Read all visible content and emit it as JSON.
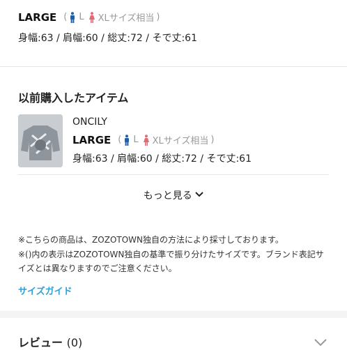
{
  "current_size": {
    "size_name": "LARGE",
    "paren_open": "(",
    "male_label": "L",
    "female_label": "XLサイズ相当",
    "paren_close": ")",
    "measurements": "身幅:63 / 肩幅:60 / 総丈:72 / そで丈:61"
  },
  "previous": {
    "title": "以前購入したアイテム",
    "item": {
      "brand": "ONCILY",
      "size_name": "LARGE",
      "paren_open": "(",
      "male_label": "L",
      "female_label": "XLサイズ相当",
      "paren_close": ")",
      "measurements": "身幅:63 / 肩幅:60 / 総丈:72 / そで丈:61"
    },
    "more_label": "もっと見る"
  },
  "notes": {
    "line1": "※こちらの商品は、ZOZOTOWN独自の方法により採寸しております。",
    "line2": "※()内の表示はZOZOTOWN独自の基準で振り分けたサイズです。ブランド表記サイズとは異なりますのでご注意ください。",
    "size_guide": "サイズガイド"
  },
  "review": {
    "label": "レビュー",
    "count": "(0)"
  },
  "colors": {
    "male_icon": "#1e5fa8",
    "female_icon": "#e06a75",
    "link": "#2fa0d8"
  },
  "icons": [
    "man-icon",
    "woman-icon",
    "chevron-down-icon"
  ]
}
